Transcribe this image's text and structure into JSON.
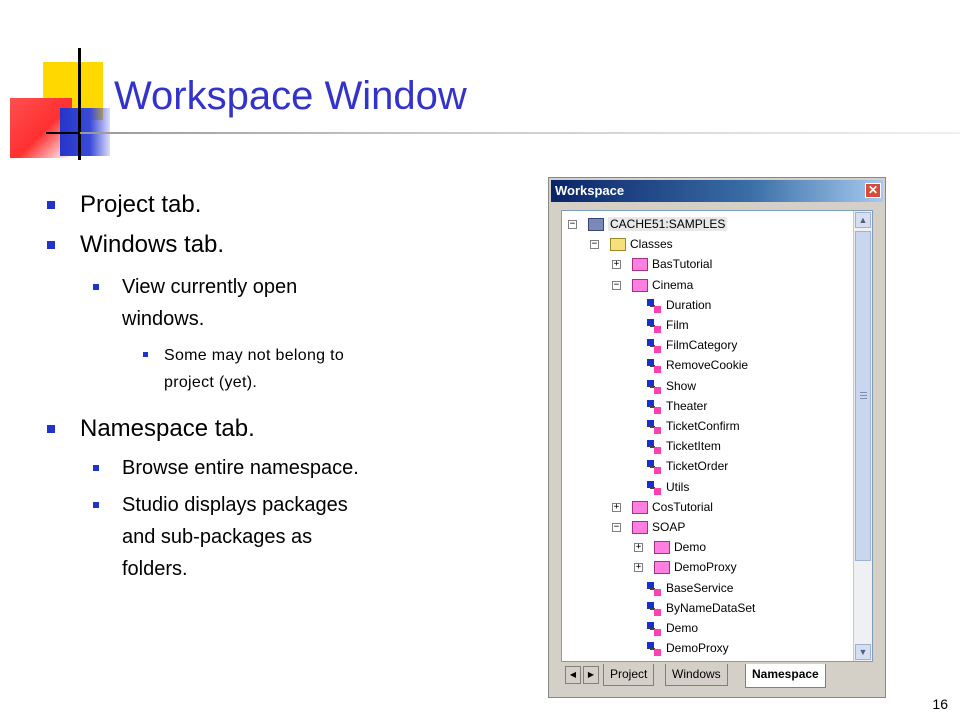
{
  "slide": {
    "title": "Workspace Window",
    "page_number": "16",
    "accent_color": "#3333cc",
    "bullet_color": "#2233cc"
  },
  "bullets": [
    {
      "level": 1,
      "text": "Project tab."
    },
    {
      "level": 1,
      "text": "Windows tab."
    },
    {
      "level": 2,
      "text": "View currently open"
    },
    {
      "level": 2,
      "text": "windows."
    },
    {
      "level": 3,
      "text": "Some may not belong to"
    },
    {
      "level": 3,
      "text": "project (yet)."
    },
    {
      "level": 1,
      "text": "Namespace tab."
    },
    {
      "level": 2,
      "text": "Browse entire namespace."
    },
    {
      "level": 2,
      "text": "Studio displays packages"
    },
    {
      "level": 2,
      "text": "and sub-packages as"
    },
    {
      "level": 2,
      "text": "folders."
    }
  ],
  "workspace": {
    "title": "Workspace",
    "close_icon": "close-icon",
    "tree": [
      {
        "label": "CACHE51:SAMPLES",
        "icon": "database-icon",
        "expander": "−"
      },
      {
        "label": "Classes",
        "icon": "folder-open-icon",
        "expander": "−"
      },
      {
        "label": "BasTutorial",
        "icon": "package-folder-icon",
        "expander": "+"
      },
      {
        "label": "Cinema",
        "icon": "package-folder-icon",
        "expander": "−"
      },
      {
        "label": "Duration",
        "icon": "class-icon"
      },
      {
        "label": "Film",
        "icon": "class-icon"
      },
      {
        "label": "FilmCategory",
        "icon": "class-icon"
      },
      {
        "label": "RemoveCookie",
        "icon": "class-icon"
      },
      {
        "label": "Show",
        "icon": "class-icon"
      },
      {
        "label": "Theater",
        "icon": "class-icon"
      },
      {
        "label": "TicketConfirm",
        "icon": "class-icon"
      },
      {
        "label": "TicketItem",
        "icon": "class-icon"
      },
      {
        "label": "TicketOrder",
        "icon": "class-icon"
      },
      {
        "label": "Utils",
        "icon": "class-icon"
      },
      {
        "label": "CosTutorial",
        "icon": "package-folder-icon",
        "expander": "+"
      },
      {
        "label": "SOAP",
        "icon": "package-folder-icon",
        "expander": "−"
      },
      {
        "label": "Demo",
        "icon": "package-folder-icon",
        "expander": "+"
      },
      {
        "label": "DemoProxy",
        "icon": "package-folder-icon",
        "expander": "+"
      },
      {
        "label": "BaseService",
        "icon": "class-icon"
      },
      {
        "label": "ByNameDataSet",
        "icon": "class-icon"
      },
      {
        "label": "Demo",
        "icon": "class-icon"
      },
      {
        "label": "DemoProxy",
        "icon": "class-icon"
      }
    ],
    "tabs": [
      {
        "label": "Project",
        "active": false
      },
      {
        "label": "Windows",
        "active": false
      },
      {
        "label": "Namespace",
        "active": true
      }
    ]
  }
}
